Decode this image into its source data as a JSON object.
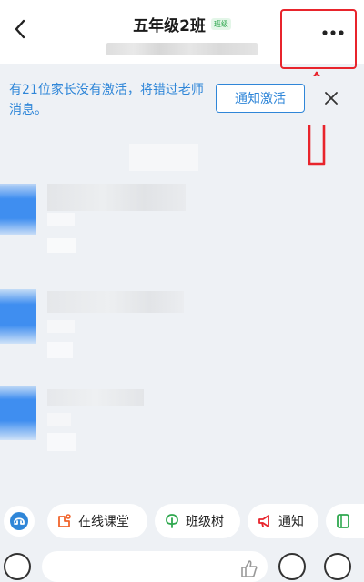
{
  "header": {
    "title": "五年级2班",
    "badge": "班级",
    "back_icon": "chevron-left-icon",
    "more_icon": "more-horizontal-icon"
  },
  "notice": {
    "text": "有21位家长没有激活，将错过老师消息。",
    "button_label": "通知激活",
    "close_icon": "close-icon"
  },
  "action_bar": {
    "assistant_icon": "assistant-icon",
    "chips": [
      {
        "label": "在线课堂",
        "icon": "online-class-icon"
      },
      {
        "label": "班级树",
        "icon": "class-tree-icon"
      },
      {
        "label": "通知",
        "icon": "megaphone-icon"
      }
    ]
  },
  "annotation": {
    "color": "#e8242c",
    "shape": "up-arrow"
  },
  "colors": {
    "accent": "#2f86d8",
    "background": "#eef1f5",
    "badge_green": "#2fa84f"
  }
}
